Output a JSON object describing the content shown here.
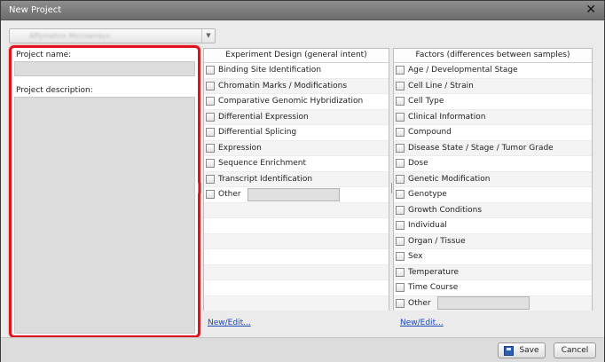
{
  "dialog": {
    "title": "New Project",
    "close_glyph": "✕"
  },
  "project_select": {
    "value": "Affymetrix Microarrays",
    "arrow_glyph": "▼"
  },
  "left_panel": {
    "name_label": "Project name:",
    "name_value": "",
    "description_label": "Project description:",
    "description_value": ""
  },
  "experiment_design": {
    "header": "Experiment Design (general intent)",
    "items": [
      {
        "label": "Binding Site Identification"
      },
      {
        "label": "Chromatin Marks / Modifications"
      },
      {
        "label": "Comparative Genomic Hybridization"
      },
      {
        "label": "Differential Expression"
      },
      {
        "label": "Differential Splicing"
      },
      {
        "label": "Expression"
      },
      {
        "label": "Sequence Enrichment"
      },
      {
        "label": "Transcript Identification"
      }
    ],
    "other_label": "Other",
    "other_value": "",
    "new_edit_link": "New/Edit..."
  },
  "factors": {
    "header": "Factors (differences between samples)",
    "items": [
      {
        "label": "Age / Developmental Stage"
      },
      {
        "label": "Cell Line / Strain"
      },
      {
        "label": "Cell Type"
      },
      {
        "label": "Clinical Information"
      },
      {
        "label": "Compound"
      },
      {
        "label": "Disease State / Stage / Tumor Grade"
      },
      {
        "label": "Dose"
      },
      {
        "label": "Genetic Modification"
      },
      {
        "label": "Genotype"
      },
      {
        "label": "Growth Conditions"
      },
      {
        "label": "Individual"
      },
      {
        "label": "Organ / Tissue"
      },
      {
        "label": "Sex"
      },
      {
        "label": "Temperature"
      },
      {
        "label": "Time Course"
      }
    ],
    "other_label": "Other",
    "other_value": "",
    "new_edit_link": "New/Edit..."
  },
  "footer": {
    "save_label": "Save",
    "cancel_label": "Cancel"
  },
  "colors": {
    "highlight": "#e0141c",
    "link": "#1a46b8",
    "save_icon": "#2f5fb3"
  },
  "icons": {
    "close": "close-icon",
    "dropdown": "chevron-down-icon",
    "save": "floppy-disk-icon",
    "splitter": "splitter-grip-icon"
  }
}
